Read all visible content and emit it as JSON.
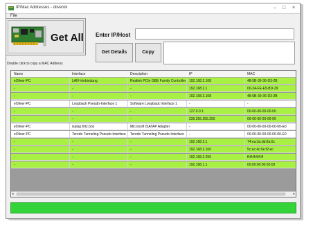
{
  "window": {
    "title": "IP/Mac Addresses - oliverok"
  },
  "menu": {
    "file": "File"
  },
  "toolbar": {
    "get_all": "Get All",
    "hint": "Double click to copy a MAC Address",
    "host_label": "Enter IP/Host",
    "host_value": "",
    "get_details": "Get Details",
    "copy": "Copy"
  },
  "table": {
    "columns": [
      "Name",
      "Interface",
      "Description",
      "IP",
      "MAC"
    ],
    "rows": [
      [
        "eOliver-PC",
        "LAN-Verbindung",
        "Realtek PCIe GBE Family Controller",
        "192.168.2.108",
        "48-5B-39-36-D3-2B"
      ],
      [
        "-",
        "-",
        "-",
        "192.168.2.1",
        "00-24-FE-E5-BD-29"
      ],
      [
        "-",
        "-",
        "-",
        "192.168.2.108",
        "48-5B-39-36-D3-2B"
      ],
      [
        "eOliver-PC",
        "Loopback Pseudo-Interface 1",
        "Software Loopback Interface 1",
        "-",
        "-"
      ],
      [
        "-",
        "-",
        "-",
        "127.0.0.1",
        "00-00-00-00-00-00"
      ],
      [
        "-",
        "-",
        "-",
        "239.255.255.250",
        "00-00-00-00-00-00"
      ],
      [
        "eOliver-PC",
        "isatap.fritz.box",
        "Microsoft ISATAP Adapter",
        "-",
        "00-00-00-00-00-00-00-E0"
      ],
      [
        "eOliver-PC",
        "Teredo Tunneling Pseudo-Interface",
        "Teredo Tunneling Pseudo-Interface",
        "-",
        "00-00-00-00-00-00-00-E0"
      ],
      [
        "-",
        "-",
        "-",
        "192.168.2.1",
        "74:ea:3a:dd:8a:6c"
      ],
      [
        "-",
        "-",
        "-",
        "192.168.2.100",
        "5c:ac:4c:0e:f2:ec"
      ],
      [
        "-",
        "-",
        "-",
        "192.168.2.255",
        "ff:ff:ff:ff:ff:ff"
      ],
      [
        "-",
        "-",
        "-",
        "192.168.1.1",
        "00:00:00:00:00:00"
      ]
    ],
    "row_colors": [
      "green",
      "green",
      "green",
      "white",
      "green",
      "green",
      "white",
      "white",
      "green",
      "green",
      "green",
      "green"
    ],
    "colors": {
      "green": "#a9f045",
      "white": "#ffffff",
      "status": "#33d339"
    }
  },
  "icons": [
    "app-icon",
    "network-card-icon",
    "minimize-icon",
    "maximize-icon",
    "close-icon"
  ]
}
